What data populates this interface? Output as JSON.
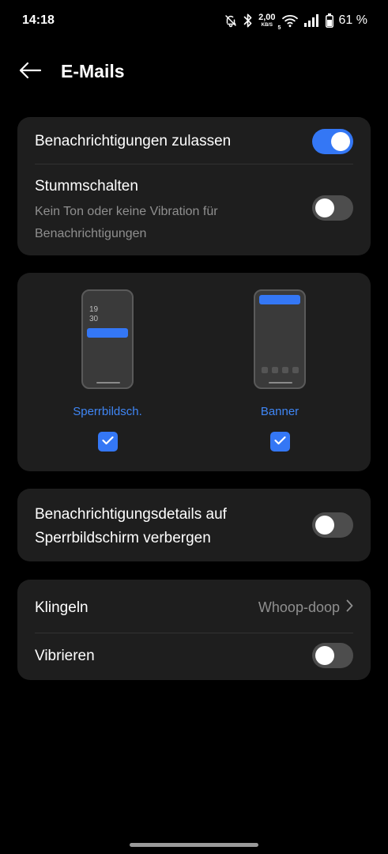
{
  "status_bar": {
    "time": "14:18",
    "net_speed_value": "2,00",
    "net_speed_unit": "KB/S",
    "network_type": "5",
    "battery_percent": "61 %",
    "icons": [
      "bell-muted-icon",
      "bluetooth-icon",
      "wifi-icon",
      "signal-icon",
      "battery-icon"
    ]
  },
  "header": {
    "back_icon": "arrow-left-icon",
    "title": "E-Mails"
  },
  "notifications_card": {
    "allow_label": "Benachrichtigungen zulassen",
    "allow_enabled": true,
    "mute_label": "Stummschalten",
    "mute_description_line1": "Kein Ton oder keine Vibration für",
    "mute_description_line2": "Benachrichtigungen",
    "mute_enabled": false
  },
  "styles_card": {
    "lockscreen": {
      "label": "Sperrbildsch.",
      "clock_hour": "19",
      "clock_minute": "30",
      "checked": true
    },
    "banner": {
      "label": "Banner",
      "checked": true
    }
  },
  "details_card": {
    "label_line1": "Benachrichtigungsdetails auf",
    "label_line2": "Sperrbildschirm verbergen",
    "enabled": false
  },
  "sound_card": {
    "ringtone_label": "Klingeln",
    "ringtone_value": "Whoop-doop",
    "vibrate_label": "Vibrieren",
    "vibrate_enabled": false
  },
  "colors": {
    "accent": "#3477f5",
    "card_background": "#1e1e1e",
    "secondary_text": "#8f8f8f"
  }
}
